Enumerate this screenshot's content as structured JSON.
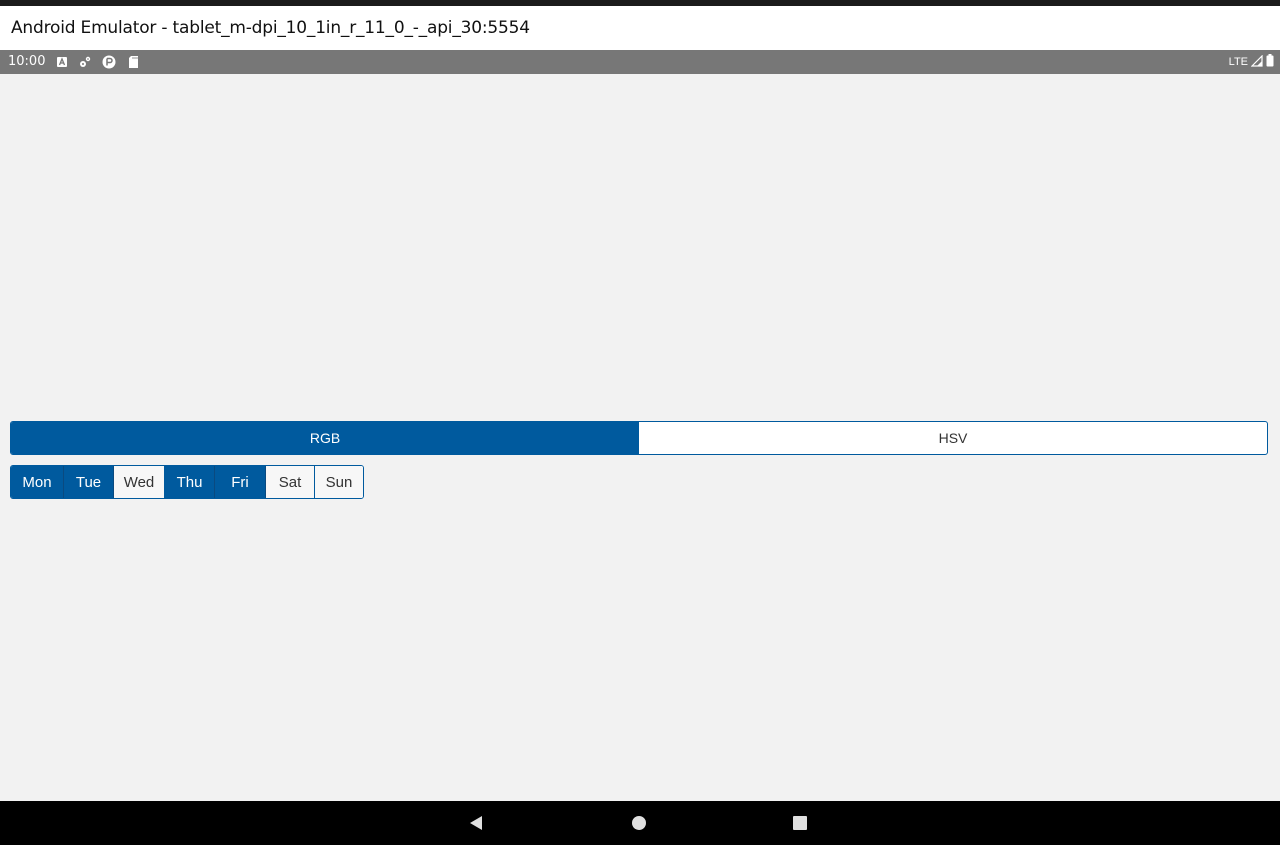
{
  "window": {
    "title": "Android Emulator - tablet_m-dpi_10_1in_r_11_0_-_api_30:5554"
  },
  "status_bar": {
    "time": "10:00",
    "left_icons": [
      "app-a-icon",
      "settings-gear-icon",
      "play-protect-icon",
      "sd-card-icon"
    ],
    "network": "LTE",
    "right_icons": [
      "signal-icon",
      "battery-icon"
    ]
  },
  "color_model_segment": {
    "options": [
      {
        "label": "RGB",
        "selected": true
      },
      {
        "label": "HSV",
        "selected": false
      }
    ]
  },
  "days_segment": {
    "options": [
      {
        "label": "Mon",
        "selected": true
      },
      {
        "label": "Tue",
        "selected": true
      },
      {
        "label": "Wed",
        "selected": false
      },
      {
        "label": "Thu",
        "selected": true
      },
      {
        "label": "Fri",
        "selected": true
      },
      {
        "label": "Sat",
        "selected": false
      },
      {
        "label": "Sun",
        "selected": false
      }
    ]
  },
  "nav_bar": {
    "buttons": [
      "back-icon",
      "home-icon",
      "recents-icon"
    ]
  },
  "colors": {
    "accent": "#005a9e",
    "status_bar": "#777777",
    "app_background": "#f2f2f2"
  }
}
